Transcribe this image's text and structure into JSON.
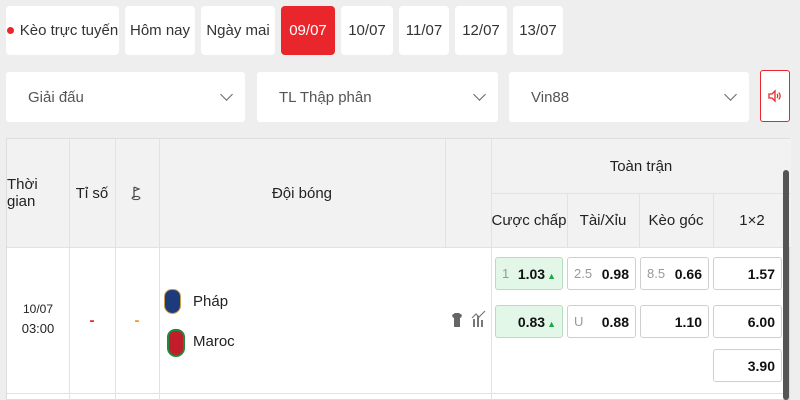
{
  "tabs": [
    {
      "label": "Kèo trực tuyến"
    },
    {
      "label": "Hôm nay"
    },
    {
      "label": "Ngày mai"
    },
    {
      "label": "09/07"
    },
    {
      "label": "10/07"
    },
    {
      "label": "11/07"
    },
    {
      "label": "12/07"
    },
    {
      "label": "13/07"
    }
  ],
  "active_tab": "09/07",
  "filters": {
    "league": "Giải đấu",
    "odds_format": "TL Thập phân",
    "bookmaker": "Vin88"
  },
  "table": {
    "headers": {
      "time": "Thời gian",
      "score": "Tỉ số",
      "teams": "Đội bóng",
      "full_match": "Toàn trận",
      "handicap": "Cược chấp",
      "over_under": "Tài/Xỉu",
      "corners": "Kèo góc",
      "one_x_two": "1×2"
    },
    "match": {
      "date": "10/07",
      "time": "03:00",
      "score": "-",
      "corner_score": "-",
      "home": "Pháp",
      "away": "Maroc",
      "handicap": {
        "line": "1",
        "home": "1.03",
        "away": "0.83"
      },
      "over_under": {
        "line": "2.5",
        "over": "0.98",
        "under_label": "U",
        "under": "0.88"
      },
      "corners": {
        "line": "8.5",
        "over": "0.66",
        "under": "1.10"
      },
      "one_x_two": {
        "home": "1.57",
        "away": "6.00",
        "draw": "3.90"
      }
    }
  },
  "colors": {
    "accent": "#e8262b",
    "up_arrow": "#1fa64a",
    "odds_highlight": "#e3f7e9"
  }
}
